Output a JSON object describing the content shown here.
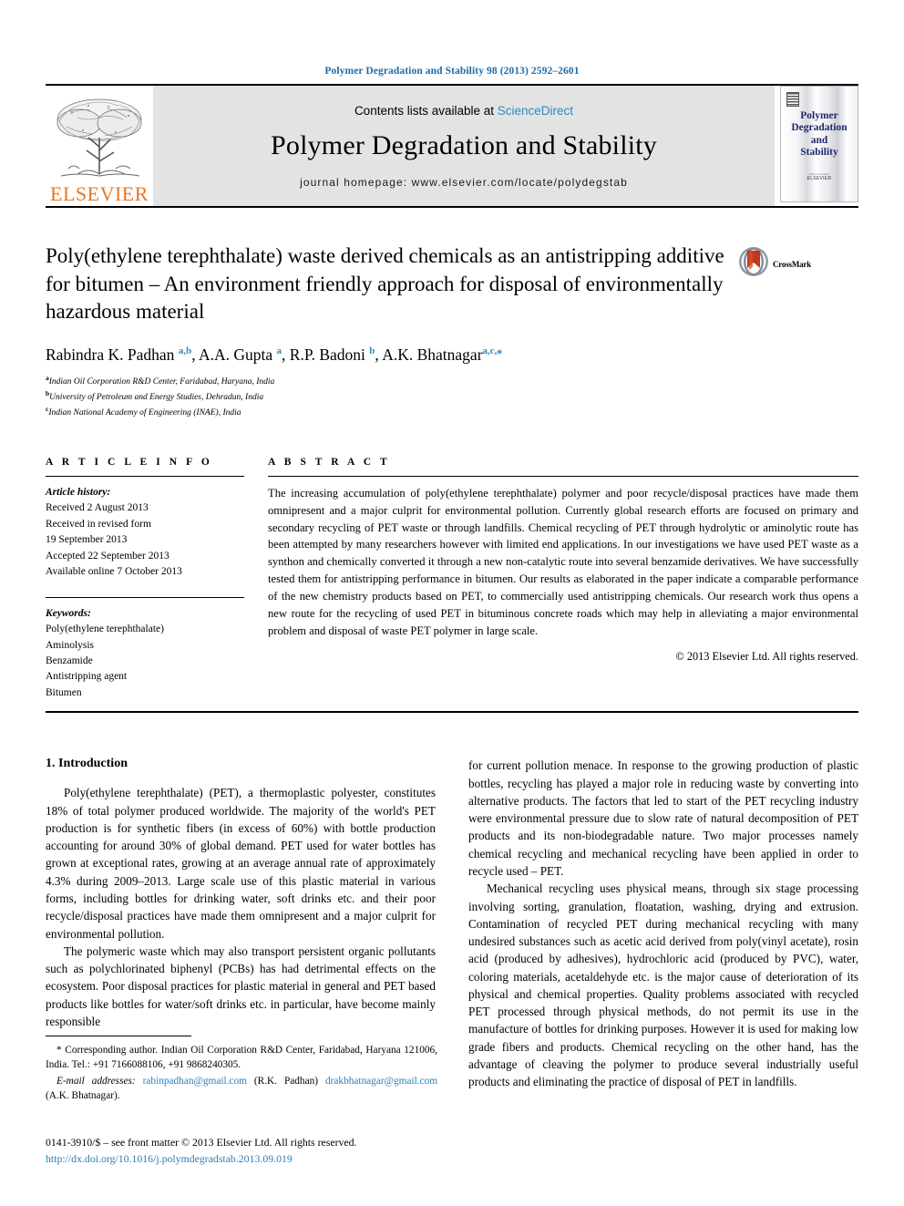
{
  "running_head": "Polymer Degradation and Stability 98 (2013) 2592–2601",
  "masthead": {
    "publisher_logo_label": "ELSEVIER",
    "contents_prefix": "Contents lists available at ",
    "contents_link": "ScienceDirect",
    "journal_title": "Polymer Degradation and Stability",
    "homepage_line": "journal homepage: www.elsevier.com/locate/polydegstab",
    "cover_title_lines": [
      "Polymer",
      "Degradation",
      "and",
      "Stability"
    ],
    "cover_footer_small": "Editor-in-Chief",
    "cover_footer_mid": "ELSEVIER"
  },
  "article": {
    "title": "Poly(ethylene terephthalate) waste derived chemicals as an antistripping additive for bitumen – An environment friendly approach for disposal of environmentally hazardous material",
    "crossmark_label": "CrossMark",
    "authors_html": "Rabindra K. Padhan <sup>a,b</sup>, A.A. Gupta <sup>a</sup>, R.P. Badoni <sup>b</sup>, A.K. Bhatnagar<sup>a,c,⁎</sup>",
    "affiliations": [
      {
        "marker": "a",
        "text": "Indian Oil Corporation R&D Center, Faridabad, Haryana, India"
      },
      {
        "marker": "b",
        "text": "University of Petroleum and Energy Studies, Dehradun, India"
      },
      {
        "marker": "c",
        "text": "Indian National Academy of Engineering (INAE), India"
      }
    ]
  },
  "article_info": {
    "heading": "A R T I C L E   I N F O",
    "history_label": "Article history:",
    "history_lines": [
      "Received 2 August 2013",
      "Received in revised form",
      "19 September 2013",
      "Accepted 22 September 2013",
      "Available online 7 October 2013"
    ],
    "keywords_label": "Keywords:",
    "keywords": [
      "Poly(ethylene terephthalate)",
      "Aminolysis",
      "Benzamide",
      "Antistripping agent",
      "Bitumen"
    ]
  },
  "abstract": {
    "heading": "A B S T R A C T",
    "text": "The increasing accumulation of poly(ethylene terephthalate) polymer and poor recycle/disposal practices have made them omnipresent and a major culprit for environmental pollution. Currently global research efforts are focused on primary and secondary recycling of PET waste or through landfills. Chemical recycling of PET through hydrolytic or aminolytic route has been attempted by many researchers however with limited end applications. In our investigations we have used PET waste as a synthon and chemically converted it through a new non-catalytic route into several benzamide derivatives. We have successfully tested them for antistripping performance in bitumen. Our results as elaborated in the paper indicate a comparable performance of the new chemistry products based on PET, to commercially used antistripping chemicals. Our research work thus opens a new route for the recycling of used PET in bituminous concrete roads which may help in alleviating a major environmental problem and disposal of waste PET polymer in large scale.",
    "copyright": "© 2013 Elsevier Ltd. All rights reserved."
  },
  "introduction": {
    "section_number_title": "1. Introduction",
    "left_paragraphs": [
      "Poly(ethylene terephthalate) (PET), a thermoplastic polyester, constitutes 18% of total polymer produced worldwide. The majority of the world's PET production is for synthetic fibers (in excess of 60%) with bottle production accounting for around 30% of global demand. PET used for water bottles has grown at exceptional rates, growing at an average annual rate of approximately 4.3% during 2009–2013. Large scale use of this plastic material in various forms, including bottles for drinking water, soft drinks etc. and their poor recycle/disposal practices have made them omnipresent and a major culprit for environmental pollution.",
      "The polymeric waste which may also transport persistent organic pollutants such as polychlorinated biphenyl (PCBs) has had detrimental effects on the ecosystem. Poor disposal practices for plastic material in general and PET based products like bottles for water/soft drinks etc. in particular, have become mainly responsible"
    ],
    "right_paragraphs": [
      "for current pollution menace. In response to the growing production of plastic bottles, recycling has played a major role in reducing waste by converting into alternative products. The factors that led to start of the PET recycling industry were environmental pressure due to slow rate of natural decomposition of PET products and its non-biodegradable nature. Two major processes namely chemical recycling and mechanical recycling have been applied in order to recycle used – PET.",
      "Mechanical recycling uses physical means, through six stage processing involving sorting, granulation, floatation, washing, drying and extrusion. Contamination of recycled PET during mechanical recycling with many undesired substances such as acetic acid derived from poly(vinyl acetate), rosin acid (produced by adhesives), hydrochloric acid (produced by PVC), water, coloring materials, acetaldehyde etc. is the major cause of deterioration of its physical and chemical properties. Quality problems associated with recycled PET processed through physical methods, do not permit its use in the manufacture of bottles for drinking purposes. However it is used for making low grade fibers and products. Chemical recycling on the other hand, has the advantage of cleaving the polymer to produce several industrially useful products and eliminating the practice of disposal of PET in landfills."
    ]
  },
  "footnotes": {
    "corresponding": "* Corresponding author. Indian Oil Corporation R&D Center, Faridabad, Haryana 121006, India. Tel.: +91 7166088106, +91 9868240305.",
    "email_label": "E-mail addresses:",
    "email_1": "rabinpadhan@gmail.com",
    "email_1_owner": "(R.K. Padhan)",
    "email_2": "drakbhatnagar@gmail.com",
    "email_2_owner": "(A.K. Bhatnagar).",
    "issn_line": "0141-3910/$ – see front matter © 2013 Elsevier Ltd. All rights reserved.",
    "doi_line": "http://dx.doi.org/10.1016/j.polymdegradstab.2013.09.019"
  },
  "colors": {
    "link_blue": "#2b7fb8",
    "sciencedirect_blue": "#2b8cbe",
    "elsevier_orange": "#E87722",
    "cover_navy": "#1d2a6b",
    "masthead_gray": "#e3e3e3"
  }
}
